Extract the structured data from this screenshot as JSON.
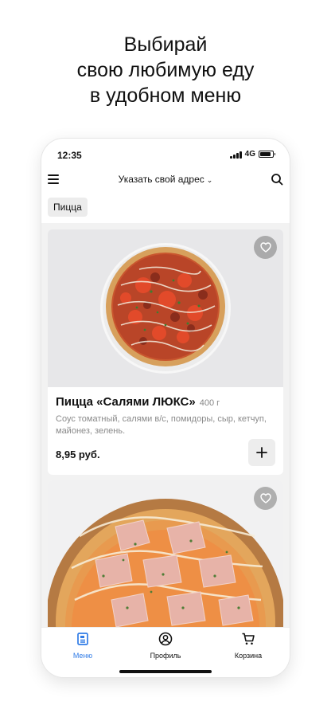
{
  "promo": {
    "line1": "Выбирай",
    "line2": "свою любимую еду",
    "line3": "в удобном меню"
  },
  "status_bar": {
    "time": "12:35",
    "network": "4G",
    "icons": [
      "signal-icon",
      "battery-icon"
    ]
  },
  "header": {
    "menu_icon": "hamburger-icon",
    "address_label": "Указать свой адрес",
    "address_icon": "chevron-down-icon",
    "search_icon": "search-icon"
  },
  "category_chip": "Пицца",
  "products": [
    {
      "title": "Пицца «Салями ЛЮКС»",
      "weight": "400 г",
      "description": "Соус томатный, салями в/с, помидоры, сыр, кетчуп, майонез, зелень.",
      "price": "8,95 руб.",
      "favorite_icon": "heart-icon",
      "add_icon": "plus-icon"
    },
    {
      "favorite_icon": "heart-icon"
    }
  ],
  "tabbar": {
    "items": [
      {
        "label": "Меню",
        "icon": "menu-doc-icon",
        "active": true
      },
      {
        "label": "Профиль",
        "icon": "profile-icon",
        "active": false
      },
      {
        "label": "Корзина",
        "icon": "cart-icon",
        "active": false
      }
    ]
  },
  "colors": {
    "accent": "#2f7be6",
    "background": "#f2f2f2"
  }
}
